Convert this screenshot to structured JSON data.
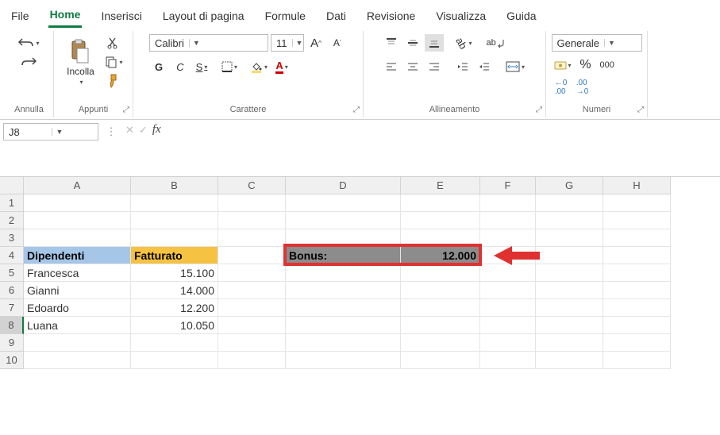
{
  "menu": {
    "file": "File",
    "home": "Home",
    "insert": "Inserisci",
    "pagelayout": "Layout di pagina",
    "formulas": "Formule",
    "data": "Dati",
    "review": "Revisione",
    "view": "Visualizza",
    "help": "Guida"
  },
  "ribbon": {
    "undo_group": "Annulla",
    "clipboard_group": "Appunti",
    "paste_label": "Incolla",
    "font_group": "Carattere",
    "font_name": "Calibri",
    "font_size": "11",
    "bold": "G",
    "italic": "C",
    "underline": "S",
    "alignment_group": "Allineamento",
    "wrap": "ab",
    "number_group": "Numeri",
    "number_format": "Generale",
    "increase_dec": ".0",
    "decrease_dec": ".00",
    "thousands": "000"
  },
  "namebox": "J8",
  "columns": [
    "A",
    "B",
    "C",
    "D",
    "E",
    "F",
    "G",
    "H"
  ],
  "rows": [
    "1",
    "2",
    "3",
    "4",
    "5",
    "6",
    "7",
    "8",
    "9",
    "10"
  ],
  "sheet": {
    "A4": "Dipendenti",
    "B4": "Fatturato",
    "D4": "Bonus:",
    "E4": "12.000",
    "A5": "Francesca",
    "B5": "15.100",
    "A6": "Gianni",
    "B6": "14.000",
    "A7": "Edoardo",
    "B7": "12.200",
    "A8": "Luana",
    "B8": "10.050"
  }
}
